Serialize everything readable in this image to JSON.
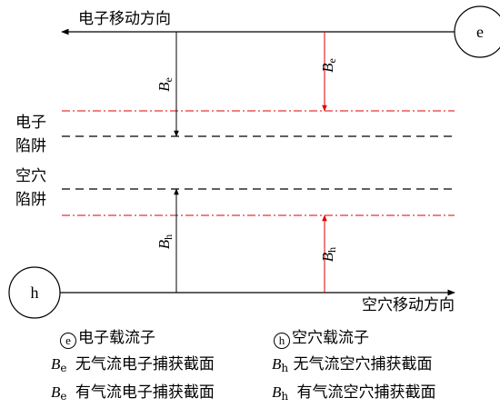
{
  "labels": {
    "electron_direction": "电子移动方向",
    "hole_direction": "空穴移动方向",
    "electron_trap": [
      "电子",
      "陷阱"
    ],
    "hole_trap": [
      "空穴",
      "陷阱"
    ],
    "electron_symbol": "e",
    "hole_symbol": "h",
    "B_symbol": "B",
    "sub_e": "e",
    "sub_h": "h"
  },
  "legend": {
    "electron_carrier": "电子载流子",
    "hole_carrier": "空穴载流子",
    "be_no_gas": "无气流电子捕获截面",
    "bh_no_gas": "无气流空穴捕获截面",
    "be_gas": "有气流电子捕获截面",
    "bh_gas": "有气流空穴捕获截面"
  },
  "colors": {
    "line": "#000000",
    "gas_flow": "#e00000"
  }
}
